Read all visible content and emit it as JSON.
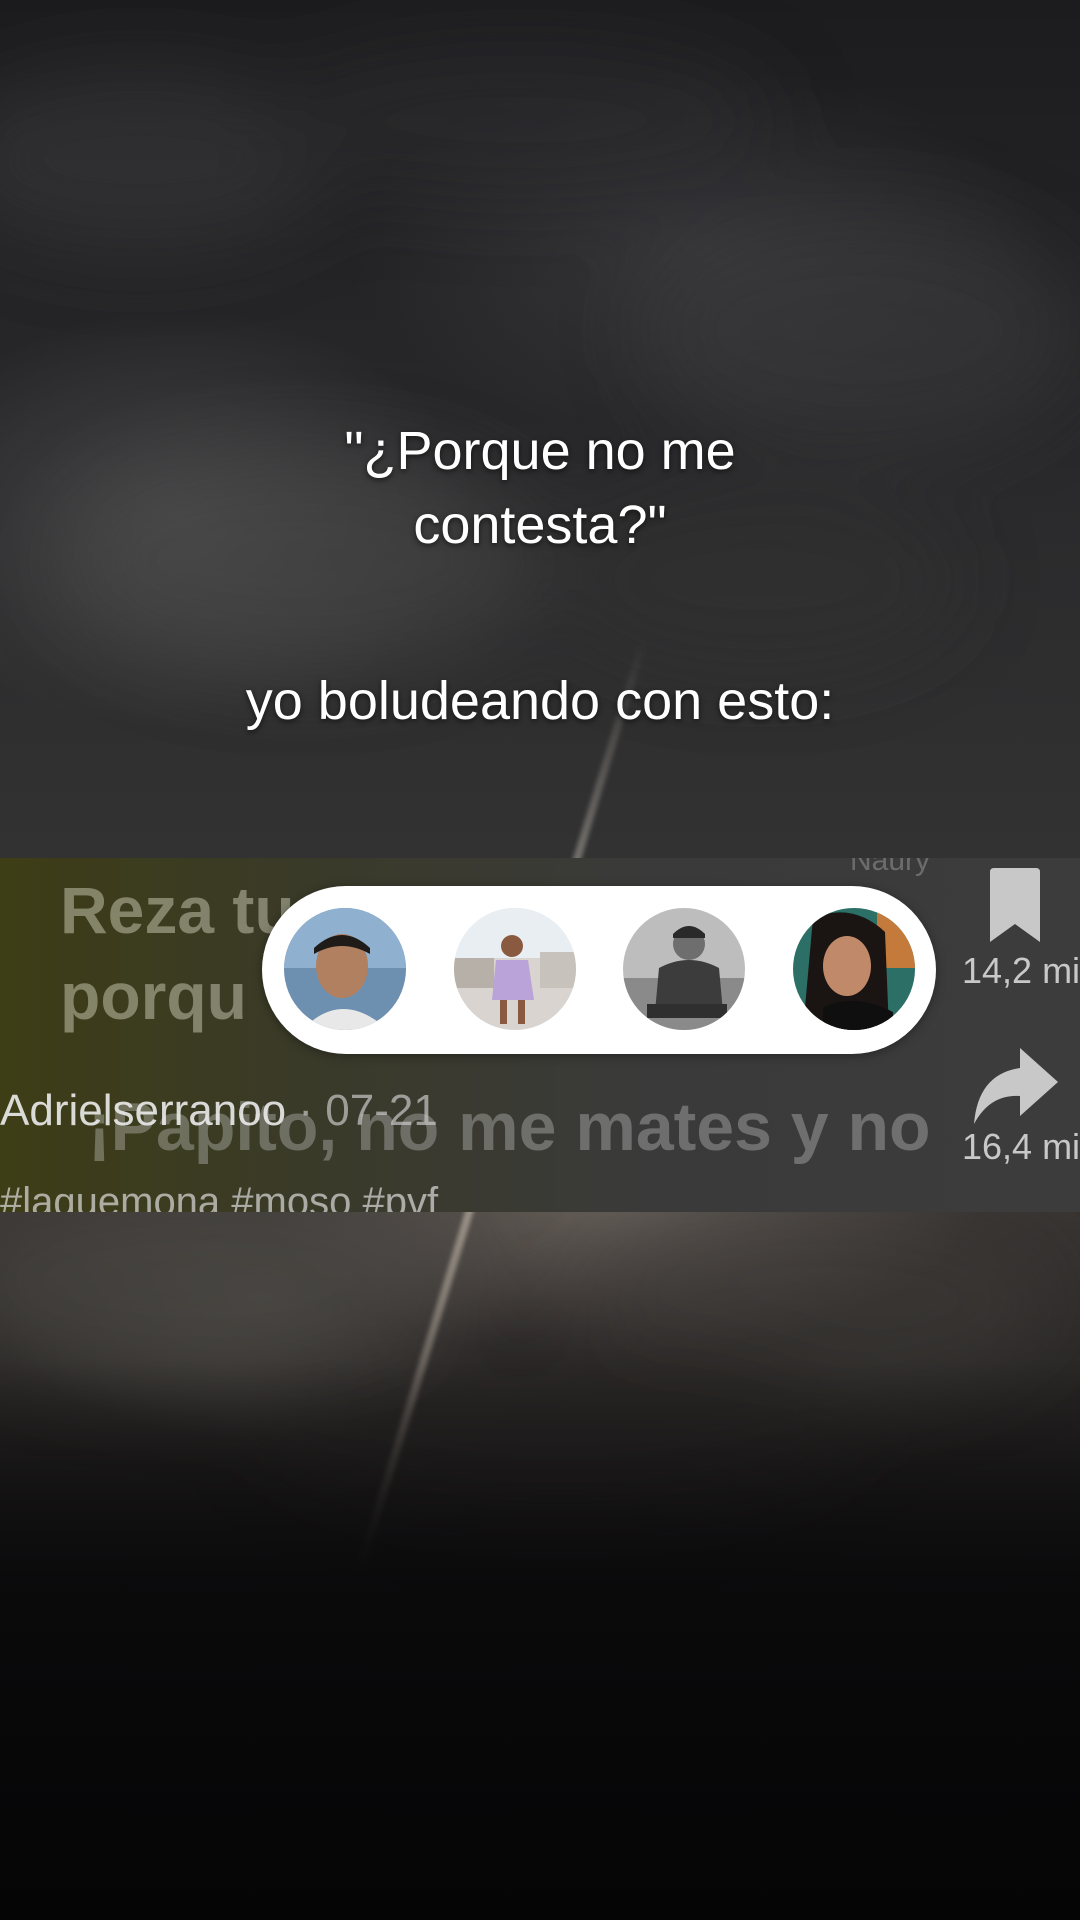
{
  "overlay": {
    "quote_line1": "\"¿Porque no me",
    "quote_line2": "contesta?\"",
    "caption": "yo boludeando con esto:"
  },
  "embedded_post": {
    "background_line1": "Reza tu",
    "background_line2": "porqu",
    "background_line3": "¡Papito, no me mates y no",
    "background_faint": "Naury",
    "author": "Adrielserranoo",
    "date": "· 07-21",
    "hashtags": "#laquemona #moso #pvf",
    "bookmark_count": "14,2 mi",
    "share_count": "16,4 mi",
    "bookmark_icon": "bookmark-icon",
    "share_icon": "share-arrow-icon"
  },
  "profile_pill": {
    "avatars": [
      {
        "icon": "avatar-photo",
        "desc_color": "#6d8fb0"
      },
      {
        "icon": "avatar-photo",
        "desc_color": "#b9a3d9"
      },
      {
        "icon": "avatar-photo",
        "desc_color": "#777777"
      },
      {
        "icon": "avatar-photo",
        "desc_color": "#b5765a"
      }
    ]
  },
  "colors": {
    "overlay_text": "#ffffff",
    "pill_background": "#ffffff",
    "embed_tint": "#3d3d16"
  }
}
